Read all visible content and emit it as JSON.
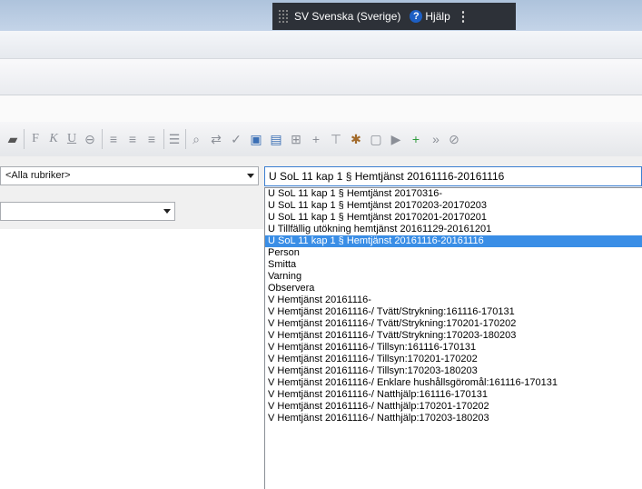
{
  "taskbar": {
    "language": "SV Svenska (Sverige)",
    "help_label": "Hjälp",
    "help_glyph": "?"
  },
  "toolbar": {
    "format_buttons": [
      "F",
      "K",
      "U",
      "⊖"
    ]
  },
  "filters": {
    "rubrik_value": "<Alla rubriker>",
    "secondary_value": ""
  },
  "dropdown": {
    "selected_value": "U SoL 11 kap 1 § Hemtjänst 20161116-20161116",
    "highlighted_index": 4,
    "options": [
      "U SoL 11 kap 1 § Hemtjänst 20170316-",
      "U SoL 11 kap 1 § Hemtjänst 20170203-20170203",
      "U SoL 11 kap 1 § Hemtjänst 20170201-20170201",
      "U Tillfällig utökning hemtjänst 20161129-20161201",
      "U SoL 11 kap 1 § Hemtjänst 20161116-20161116",
      "Person",
      "Smitta",
      "Varning",
      "Observera",
      "V Hemtjänst 20161116-",
      "V Hemtjänst 20161116-/ Tvätt/Strykning:161116-170131",
      "V Hemtjänst 20161116-/ Tvätt/Strykning:170201-170202",
      "V Hemtjänst 20161116-/ Tvätt/Strykning:170203-180203",
      "V Hemtjänst 20161116-/ Tillsyn:161116-170131",
      "V Hemtjänst 20161116-/ Tillsyn:170201-170202",
      "V Hemtjänst 20161116-/ Tillsyn:170203-180203",
      "V Hemtjänst 20161116-/ Enklare hushållsgöromål:161116-170131",
      "V Hemtjänst 20161116-/ Natthjälp:161116-170131",
      "V Hemtjänst 20161116-/ Natthjälp:170201-170202",
      "V Hemtjänst 20161116-/ Natthjälp:170203-180203"
    ]
  },
  "colors": {
    "highlight": "#3a8ee6",
    "focus_border": "#3c7fd1"
  }
}
